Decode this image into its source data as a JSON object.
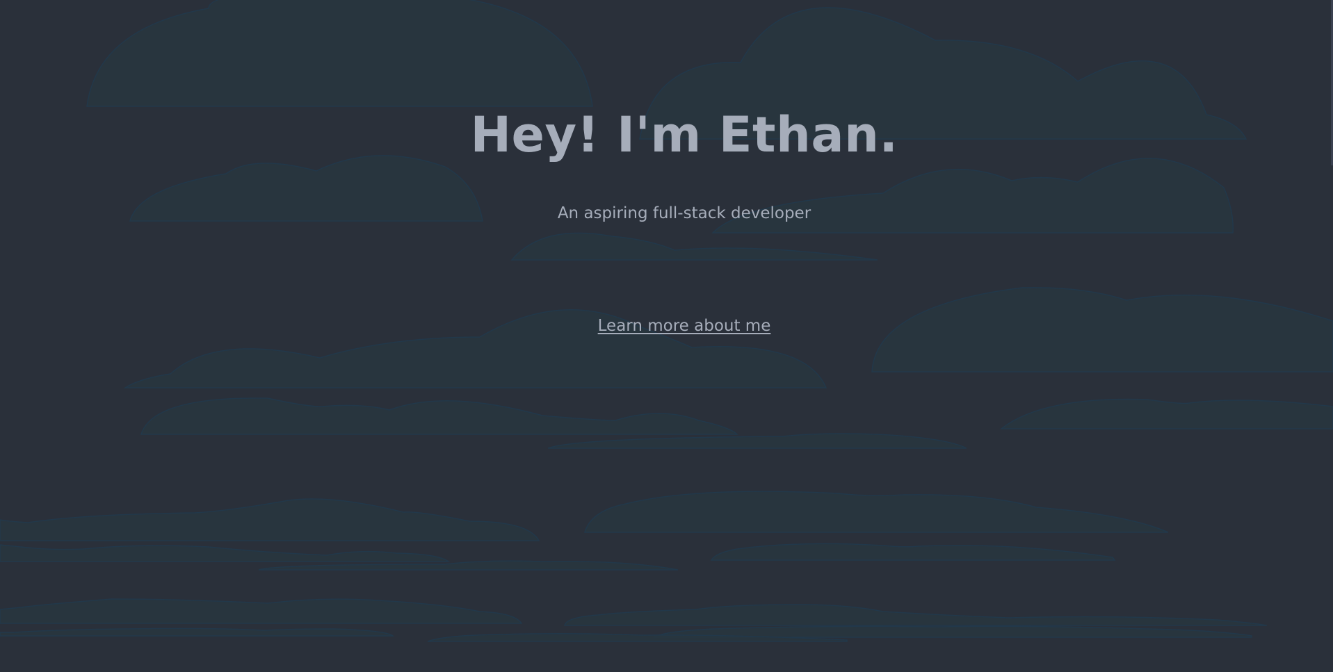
{
  "hero": {
    "title": "Hey! I'm Ethan.",
    "subtitle": "An aspiring full-stack developer",
    "link_label": "Learn more about me"
  },
  "theme": {
    "background": "#2a303a",
    "text": "#a6adba",
    "cloud_fill": "#28363f",
    "cloud_outline": "#22384a"
  }
}
